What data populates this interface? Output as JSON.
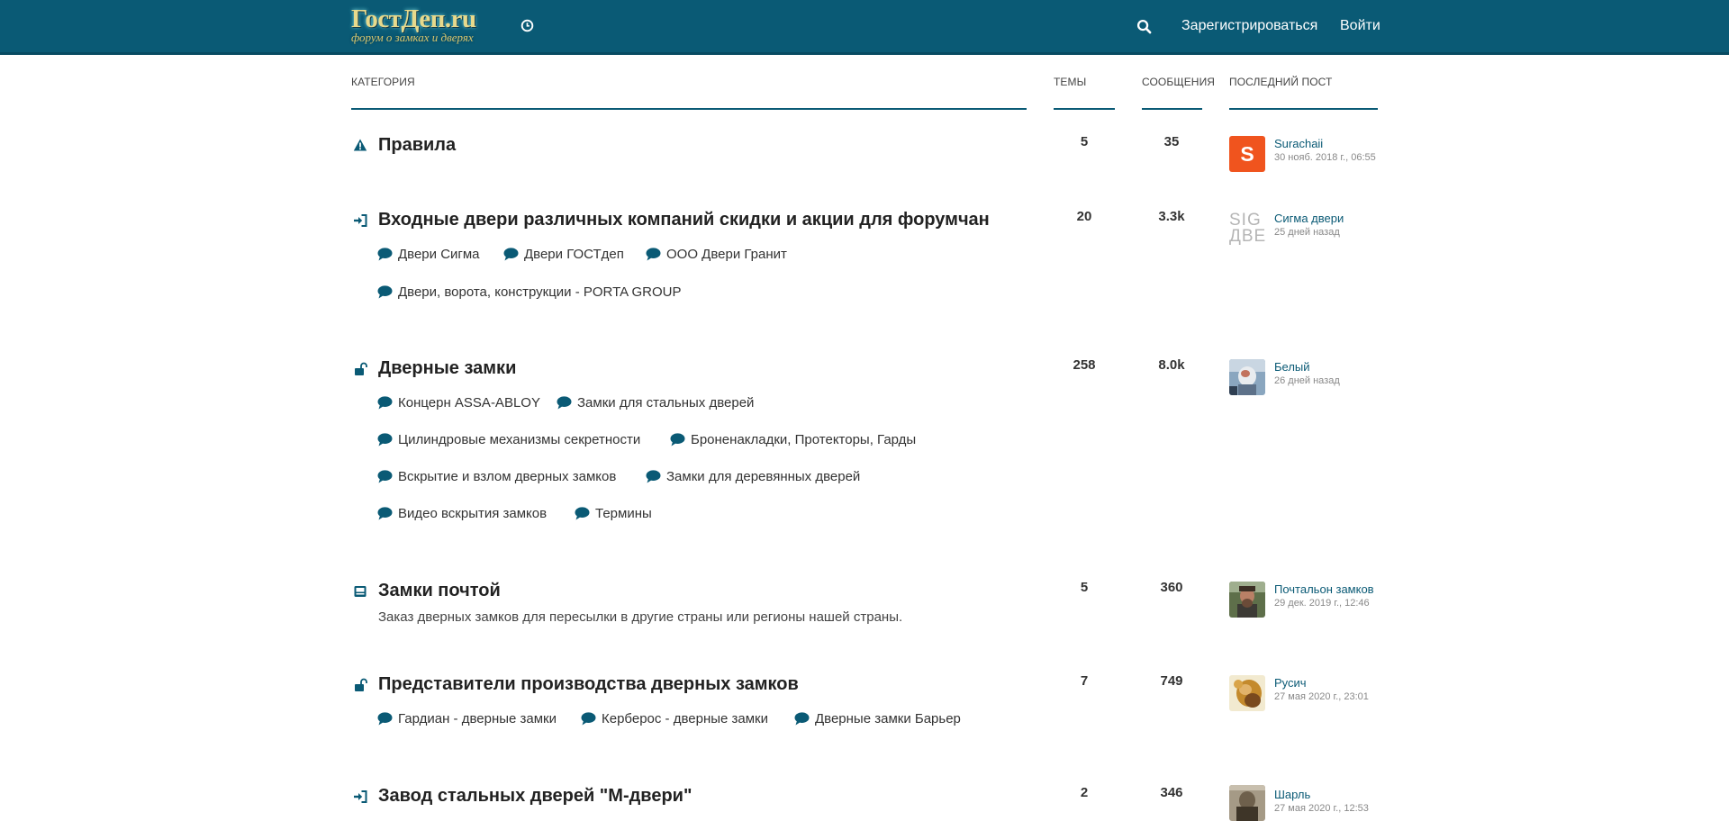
{
  "header": {
    "logo_title": "ГостДеп.ru",
    "logo_subtitle": "форум о замках и дверях",
    "register": "Зарегистрироваться",
    "login": "Войти",
    "brand_color": "#0a5a75"
  },
  "columns": {
    "category": "Категория",
    "topics": "Темы",
    "posts": "Сообщения",
    "last_post": "Последний пост"
  },
  "rows": [
    {
      "icon": "warning-icon",
      "title": "Правила",
      "topics": "5",
      "posts": "35",
      "last_user": "Surachaii",
      "last_date": "30 нояб. 2018 г., 06:55",
      "avatar_letter": "S",
      "avatar_color": "#f0541e"
    },
    {
      "icon": "sign-in-icon",
      "title": "Входные двери различных компаний скидки и акции для форумчан",
      "topics": "20",
      "posts": "3.3k",
      "subs": [
        "Двери Сигма",
        "Двери ГОСТдеп",
        "ООО Двери Гранит",
        "Двери, ворота, конструкции - PORTA GROUP"
      ],
      "last_user": "Сигма двери",
      "last_date": "25 дней назад",
      "avatar_text": "SIG ДВЕ"
    },
    {
      "icon": "unlock-icon",
      "title": "Дверные замки",
      "topics": "258",
      "posts": "8.0k",
      "subs": [
        "Концерн ASSA-ABLOY",
        "Замки для стальных дверей",
        "Цилиндровые механизмы секретности",
        "Броненакладки, Протекторы, Гарды",
        "Вскрытие и взлом дверных замков",
        "Замки для деревянных дверей",
        "Видео вскрытия замков",
        "Термины"
      ],
      "last_user": "Белый",
      "last_date": "26 дней назад"
    },
    {
      "icon": "mail-box-icon",
      "title": "Замки почтой",
      "description": "Заказ дверных замков для пересылки в другие страны или регионы нашей страны.",
      "topics": "5",
      "posts": "360",
      "last_user": "Почтальон замков",
      "last_date": "29 дек. 2019 г., 12:46"
    },
    {
      "icon": "unlock-icon",
      "title": "Представители производства дверных замков",
      "topics": "7",
      "posts": "749",
      "subs": [
        "Гардиан - дверные замки",
        "Керберос - дверные замки",
        "Дверные замки Барьер"
      ],
      "last_user": "Русич",
      "last_date": "27 мая 2020 г., 23:01"
    },
    {
      "icon": "sign-in-icon",
      "title": "Завод стальных дверей \"М-двери\"",
      "topics": "2",
      "posts": "346",
      "last_user": "Шарль",
      "last_date": "27 мая 2020 г., 12:53"
    }
  ]
}
